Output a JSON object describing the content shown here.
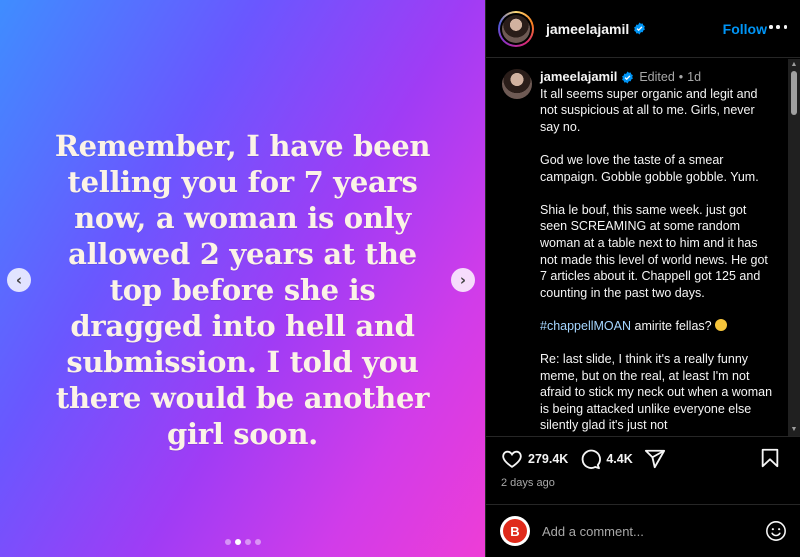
{
  "media": {
    "slide_text": "Remember, I have been telling you for 7 years now, a woman is only allowed 2 years at the top before she is dragged into hell and submission. I told you there would be another girl soon.",
    "prev_arrow": "‹",
    "next_arrow": "›",
    "dots_count": 4,
    "active_dot": 1
  },
  "header": {
    "username": "jameelajamil",
    "follow_label": "Follow"
  },
  "comment": {
    "username": "jameelajamil",
    "edited_label": "Edited",
    "separator": "•",
    "time": "1d",
    "paragraphs": [
      "It all seems super organic and legit and not suspicious at all to me. Girls, never say no.",
      "God we love the taste of a smear campaign. Gobble gobble gobble. Yum.",
      "Shia le bouf, this same week. just got seen SCREAMING at some random woman at a table next to him and it has not made this level of world news. He got 7 articles about it. Chappell got 125 and counting in the past two days."
    ],
    "hashtag": "#chappellMOAN",
    "hashtag_rest": " amirite fellas?",
    "last_paragraph": "Re: last slide, I think it's a really funny meme, but on the real, at least I'm not afraid to stick my neck out when a woman is being attacked unlike everyone else silently glad it's just not"
  },
  "actions": {
    "likes": "279.4K",
    "comments": "4.4K",
    "timestamp": "2 days ago"
  },
  "composer": {
    "avatar_letter": "B",
    "placeholder": "Add a comment..."
  },
  "colors": {
    "accent": "#0095f6",
    "verified": "#0095f6",
    "panel_bg": "#000000",
    "slide_text": "#fbf3e6"
  }
}
